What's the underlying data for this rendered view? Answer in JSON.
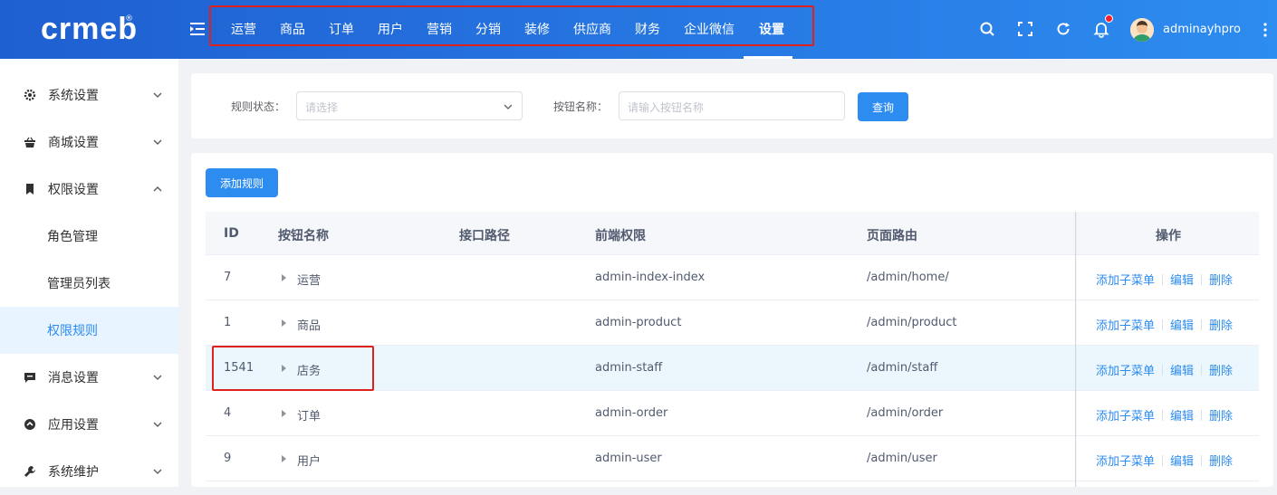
{
  "logo": {
    "text": "crmeb",
    "mark": "®"
  },
  "topnav": {
    "items": [
      "运营",
      "商品",
      "订单",
      "用户",
      "营销",
      "分销",
      "装修",
      "供应商",
      "财务",
      "企业微信",
      "设置"
    ],
    "active": "设置"
  },
  "header": {
    "username": "adminayhpro",
    "icons": [
      "search-icon",
      "fullscreen-icon",
      "refresh-icon",
      "bell-icon",
      "more-icon"
    ]
  },
  "sidebar": {
    "items": [
      {
        "label": "系统设置",
        "icon": "gear-icon",
        "expanded": false
      },
      {
        "label": "商城设置",
        "icon": "basket-icon",
        "expanded": false
      },
      {
        "label": "权限设置",
        "icon": "bookmark-icon",
        "expanded": true
      },
      {
        "label": "角色管理",
        "sub": true
      },
      {
        "label": "管理员列表",
        "sub": true
      },
      {
        "label": "权限规则",
        "sub": true,
        "selected": true
      },
      {
        "label": "消息设置",
        "icon": "message-icon",
        "expanded": false
      },
      {
        "label": "应用设置",
        "icon": "app-icon",
        "expanded": false
      },
      {
        "label": "系统维护",
        "icon": "wrench-icon",
        "expanded": false
      }
    ]
  },
  "filter": {
    "status_label": "规则状态：",
    "status_placeholder": "请选择",
    "name_label": "按钮名称：",
    "name_placeholder": "请输入按钮名称",
    "query_button": "查询"
  },
  "toolbar": {
    "add_rule": "添加规则"
  },
  "table": {
    "columns": [
      "ID",
      "按钮名称",
      "接口路径",
      "前端权限",
      "页面路由",
      "操作"
    ],
    "rows": [
      {
        "id": "7",
        "name": "运营",
        "api": "",
        "perm": "admin-index-index",
        "route": "/admin/home/"
      },
      {
        "id": "1",
        "name": "商品",
        "api": "",
        "perm": "admin-product",
        "route": "/admin/product"
      },
      {
        "id": "1541",
        "name": "店务",
        "api": "",
        "perm": "admin-staff",
        "route": "/admin/staff"
      },
      {
        "id": "4",
        "name": "订单",
        "api": "",
        "perm": "admin-order",
        "route": "/admin/order"
      },
      {
        "id": "9",
        "name": "用户",
        "api": "",
        "perm": "admin-user",
        "route": "/admin/user"
      }
    ],
    "actions": {
      "add_child": "添加子菜单",
      "edit": "编辑",
      "delete": "删除"
    }
  },
  "colors": {
    "primary": "#2d8cf0",
    "header_start": "#1f5fd1",
    "highlight_row": "#ebf7fd",
    "annotation": "#e0201b"
  }
}
